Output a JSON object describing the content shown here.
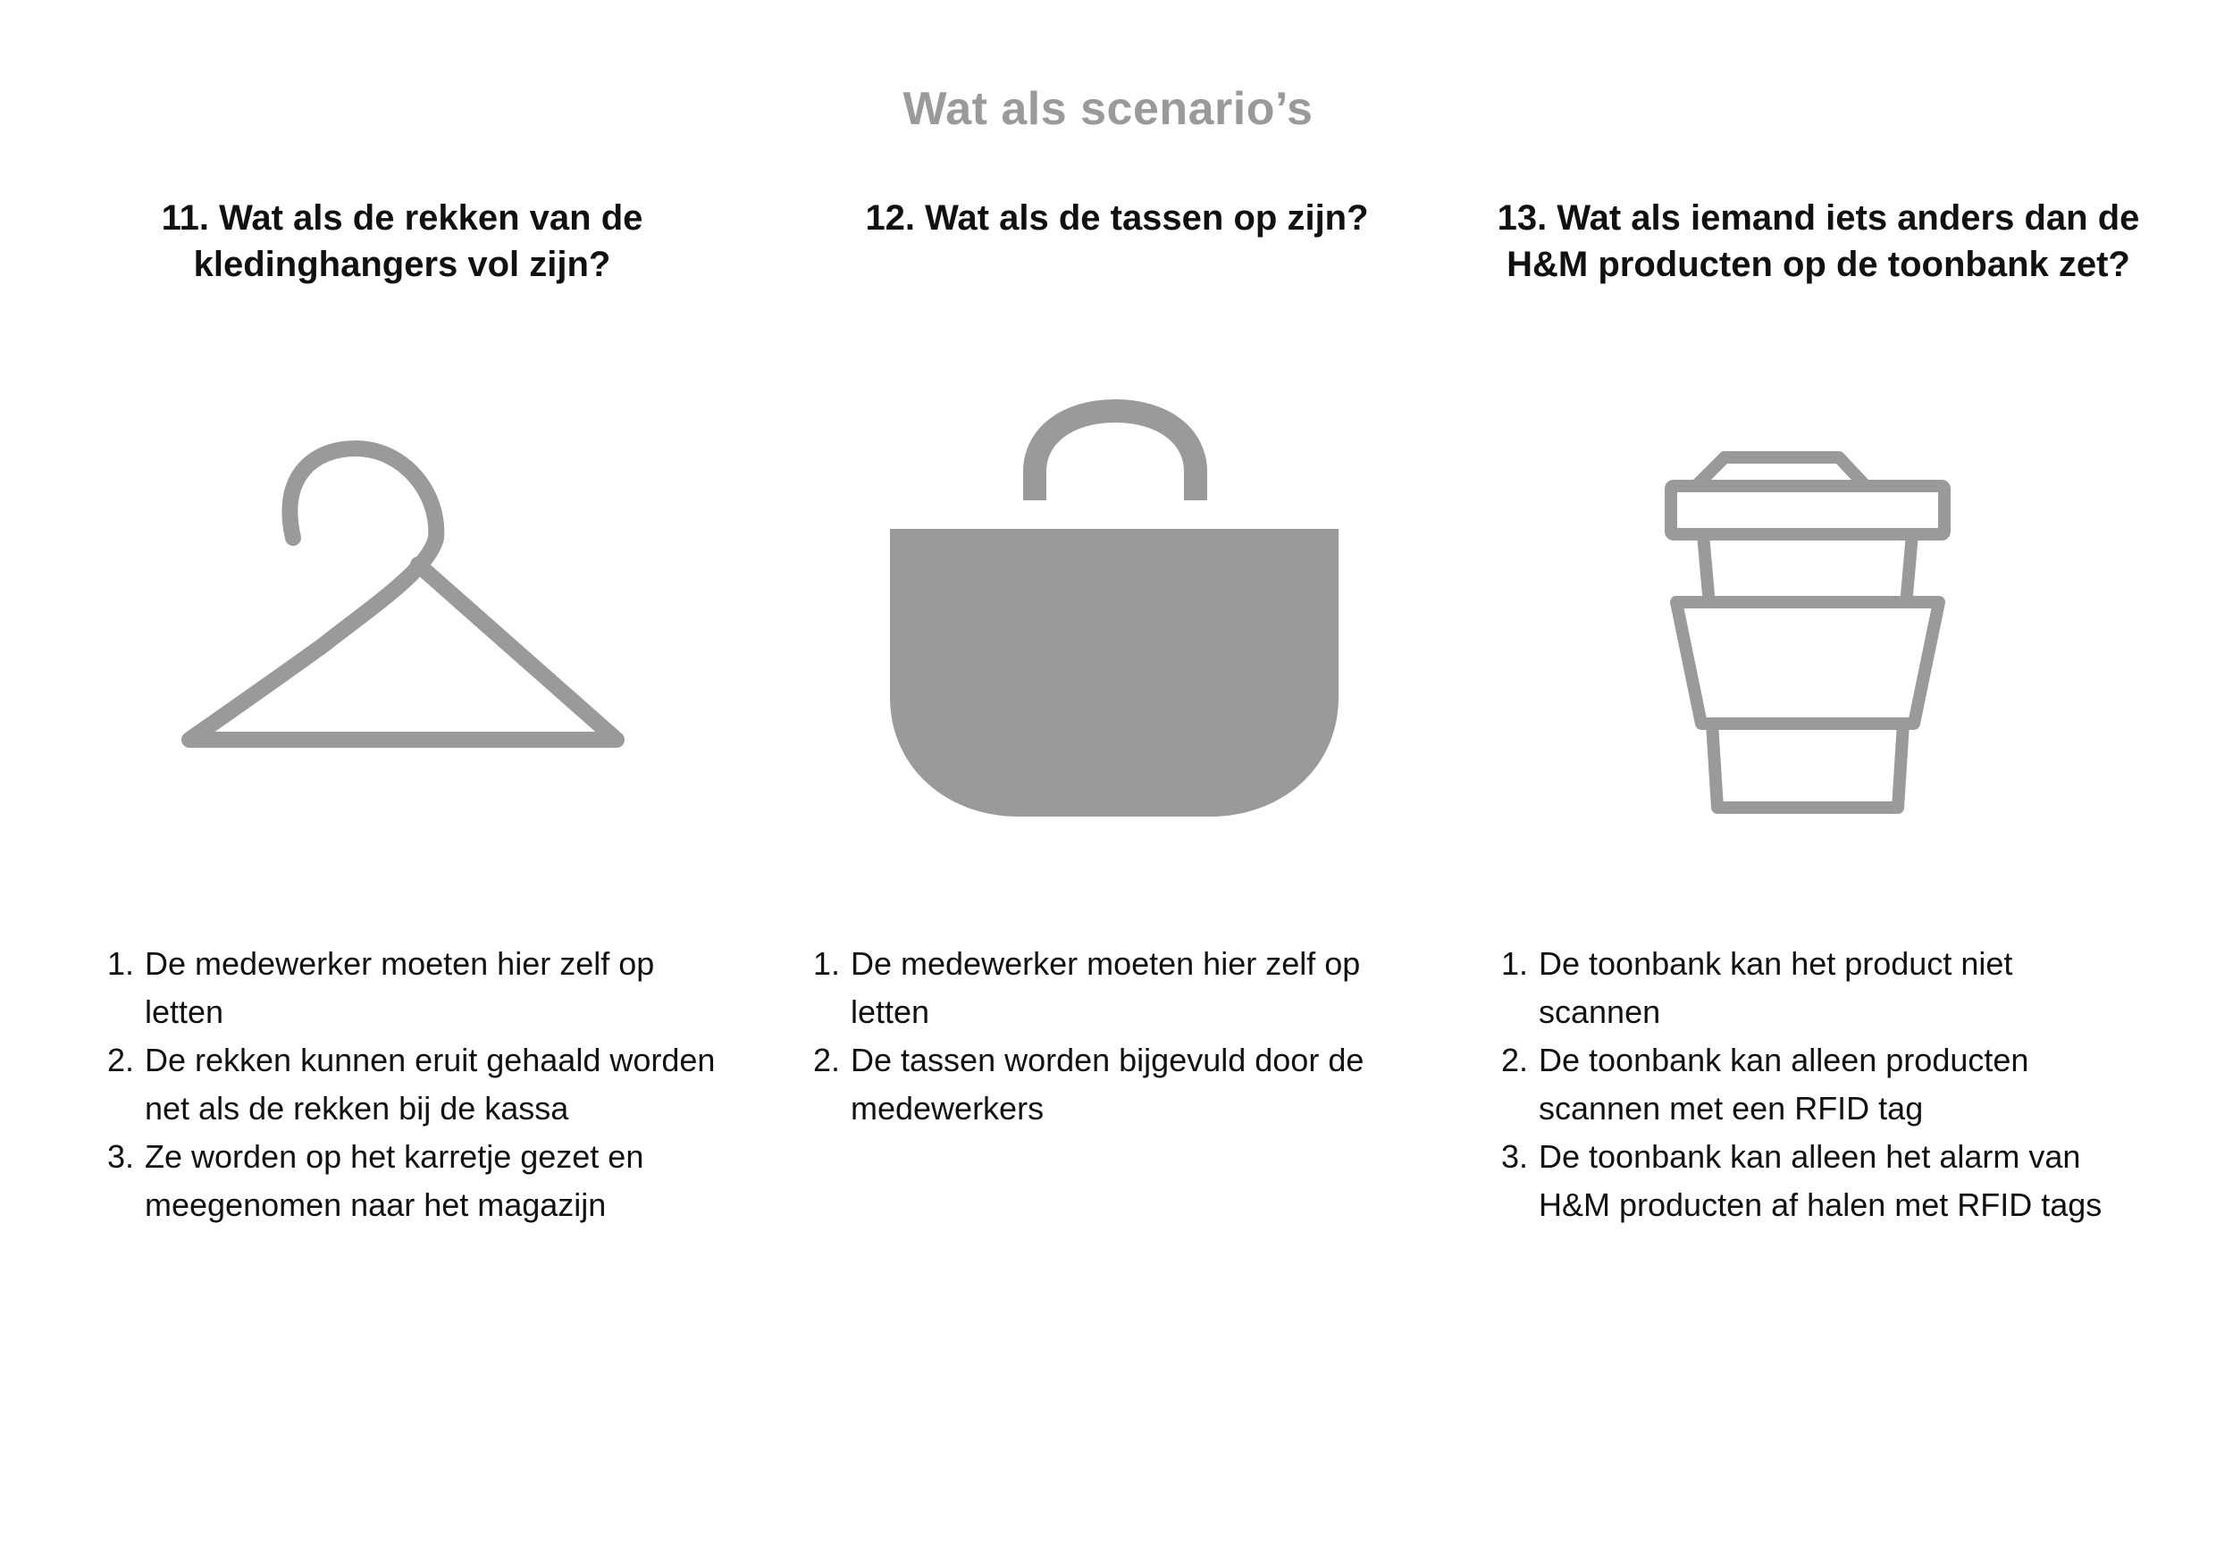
{
  "page": {
    "title": "Wat als scenario’s"
  },
  "colors": {
    "title_gray": "#9a9a9a",
    "icon_gray": "#9a9a9a",
    "text": "#111111"
  },
  "scenarios": [
    {
      "title": "11. Wat als de rekken van de kledinghangers vol zijn?",
      "icon": "hanger-icon",
      "steps": [
        {
          "num": "1.",
          "text": "De medewerker moeten hier zelf op letten"
        },
        {
          "num": "2.",
          "text": "De rekken kunnen eruit gehaald worden net als de rekken bij de kassa"
        },
        {
          "num": "3.",
          "text": "Ze worden op het karretje gezet en meegenomen naar het magazijn"
        }
      ]
    },
    {
      "title": "12. Wat als de tassen op zijn?",
      "icon": "bag-icon",
      "steps": [
        {
          "num": "1.",
          "text": "De medewerker moeten hier zelf op letten"
        },
        {
          "num": "2.",
          "text": "De tassen worden bijgevuld door de medewerkers"
        }
      ]
    },
    {
      "title": "13. Wat als iemand iets anders dan de H&M producten op de toonbank zet?",
      "icon": "cup-icon",
      "steps": [
        {
          "num": "1.",
          "text": "De toonbank kan het product niet scannen"
        },
        {
          "num": "2.",
          "text": "De toonbank kan alleen producten scannen met een RFID tag"
        },
        {
          "num": "3.",
          "text": "De toonbank kan alleen het alarm van H&M producten af halen met RFID tags"
        }
      ]
    }
  ]
}
